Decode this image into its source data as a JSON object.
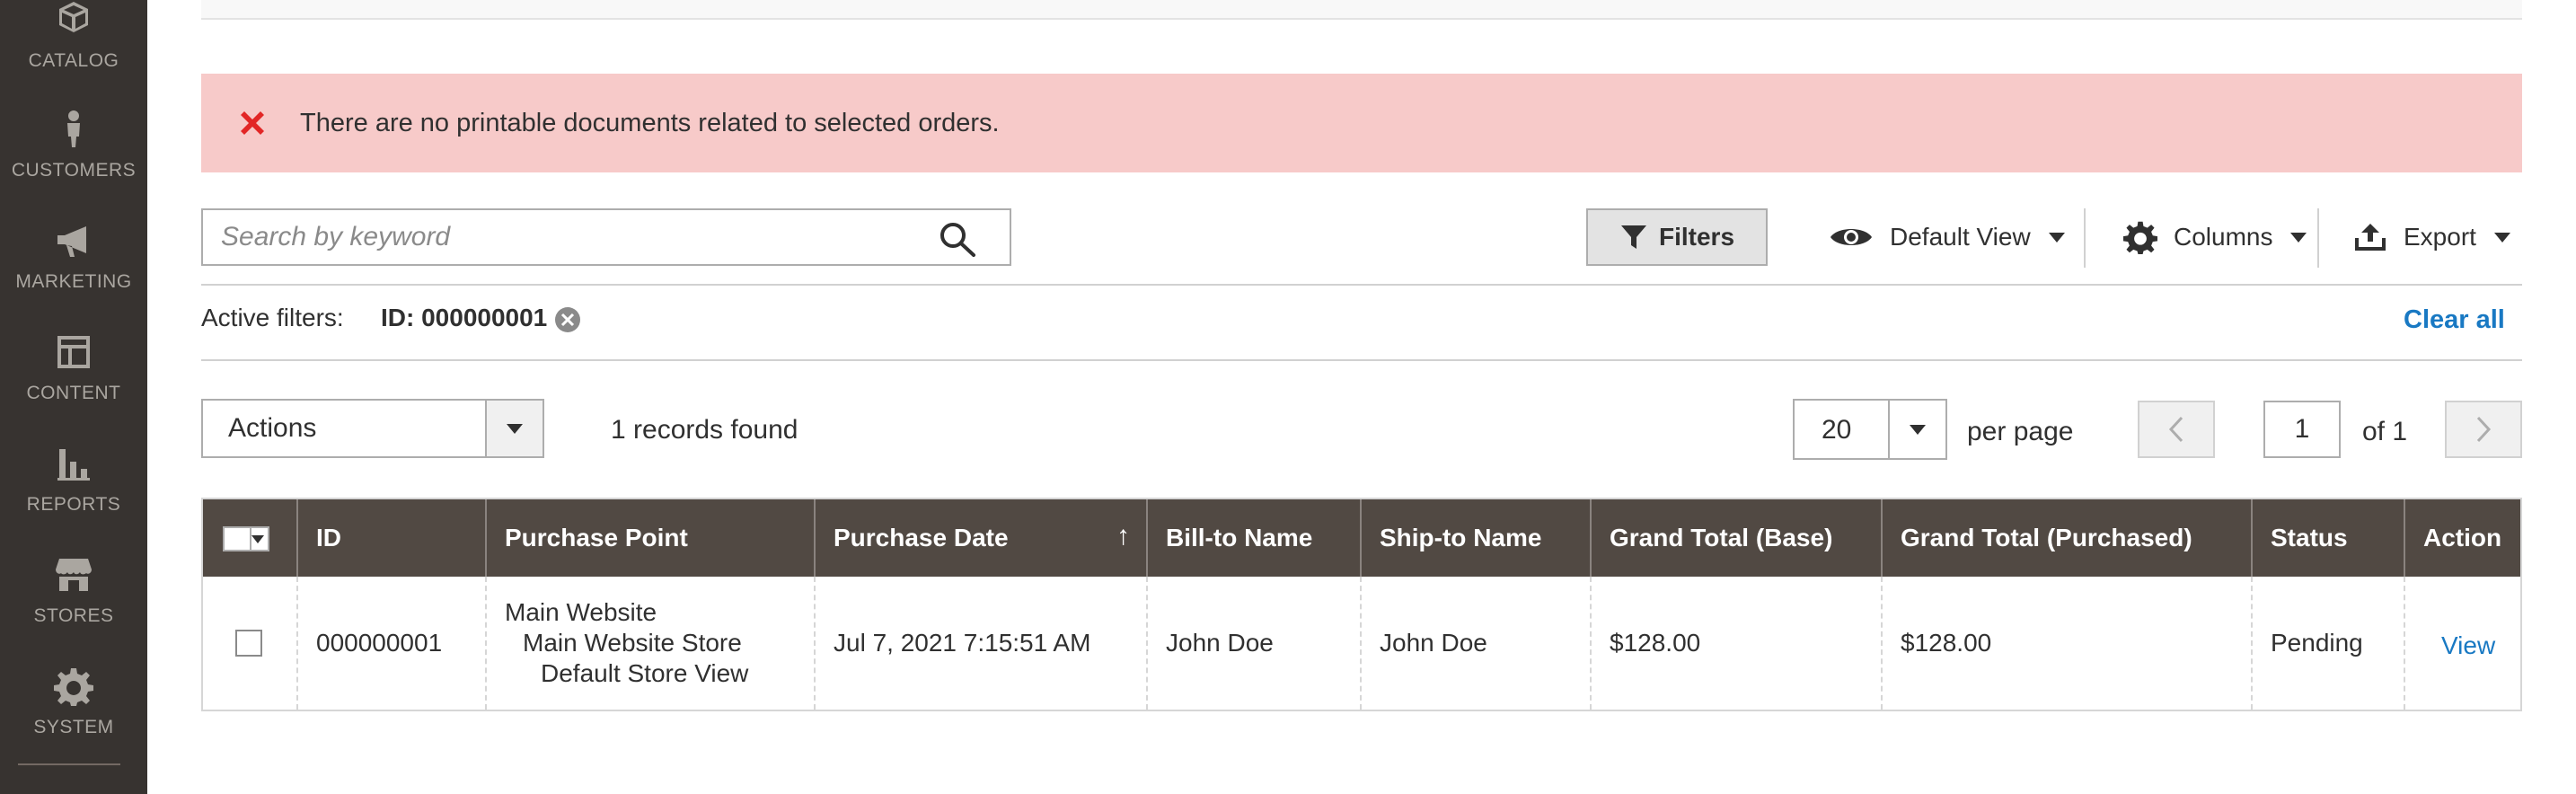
{
  "sidebar": {
    "items": [
      {
        "label": "CATALOG",
        "icon": "catalog-box-icon"
      },
      {
        "label": "CUSTOMERS",
        "icon": "customer-person-icon"
      },
      {
        "label": "MARKETING",
        "icon": "megaphone-icon"
      },
      {
        "label": "CONTENT",
        "icon": "content-layout-icon"
      },
      {
        "label": "REPORTS",
        "icon": "bar-chart-icon"
      },
      {
        "label": "STORES",
        "icon": "storefront-icon"
      },
      {
        "label": "SYSTEM",
        "icon": "gear-icon"
      }
    ]
  },
  "message": {
    "text": "There are no printable documents related to selected orders.",
    "type": "error",
    "color": "#e22626"
  },
  "search": {
    "placeholder": "Search by keyword",
    "value": ""
  },
  "toolbar": {
    "filters_label": "Filters",
    "view_label": "Default View",
    "columns_label": "Columns",
    "export_label": "Export"
  },
  "active_filters": {
    "label": "Active filters:",
    "chip": "ID: 000000001",
    "clear_all": "Clear all"
  },
  "actions": {
    "label": "Actions",
    "records_found": "1 records found"
  },
  "pagination": {
    "per_page_value": "20",
    "per_page_label": "per page",
    "current_page": "1",
    "total_text": "of 1"
  },
  "table": {
    "headers": {
      "id": "ID",
      "purchase_point": "Purchase Point",
      "purchase_date": "Purchase Date",
      "bill_to": "Bill-to Name",
      "ship_to": "Ship-to Name",
      "gt_base": "Grand Total (Base)",
      "gt_purchased": "Grand Total (Purchased)",
      "status": "Status",
      "action": "Action"
    },
    "sort_indicator": "↑",
    "rows": [
      {
        "id": "000000001",
        "purchase_point": [
          "Main Website",
          "Main Website Store",
          "Default Store View"
        ],
        "purchase_date": "Jul 7, 2021 7:15:51 AM",
        "bill_to": "John Doe",
        "ship_to": "John Doe",
        "gt_base": "$128.00",
        "gt_purchased": "$128.00",
        "status": "Pending",
        "action": "View"
      }
    ]
  },
  "colors": {
    "sidebar_bg": "#373330",
    "header_bg": "#514943",
    "error_bg": "#f7cac9",
    "link": "#1979c3"
  }
}
